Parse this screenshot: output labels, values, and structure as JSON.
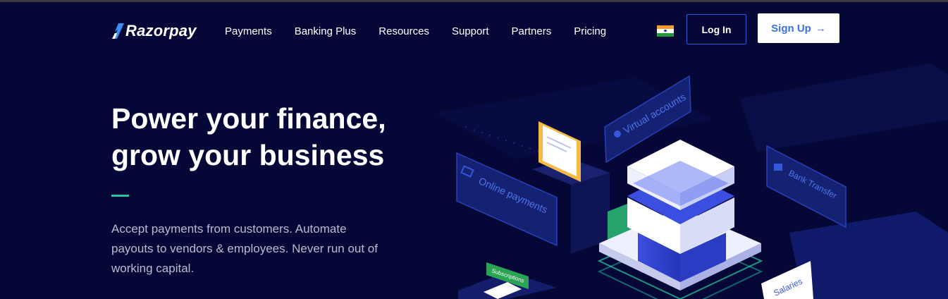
{
  "brand": {
    "name": "Razorpay",
    "logo_icon": "razorpay-logo-mark"
  },
  "nav": {
    "items": [
      "Payments",
      "Banking Plus",
      "Resources",
      "Support",
      "Partners",
      "Pricing"
    ]
  },
  "header": {
    "flag_icon": "india-flag-icon",
    "login_label": "Log In",
    "signup_label": "Sign Up",
    "signup_arrow": "→"
  },
  "hero": {
    "title_line1": "Power your finance,",
    "title_line2": "grow your business",
    "description": "Accept payments from customers. Automate payouts to vendors & employees. Never run out of working capital."
  },
  "illustration": {
    "labels": {
      "virtual_accounts": "Virtual accounts",
      "online_payments": "Online payments",
      "bank_transfer": "Bank Transfer",
      "subscriptions": "Subscriptions",
      "salaries": "Salaries"
    }
  },
  "colors": {
    "background": "#050836",
    "accent_green": "#2fc4a0",
    "primary_blue": "#3a70e8",
    "card_blue": "#1c2a7a"
  }
}
